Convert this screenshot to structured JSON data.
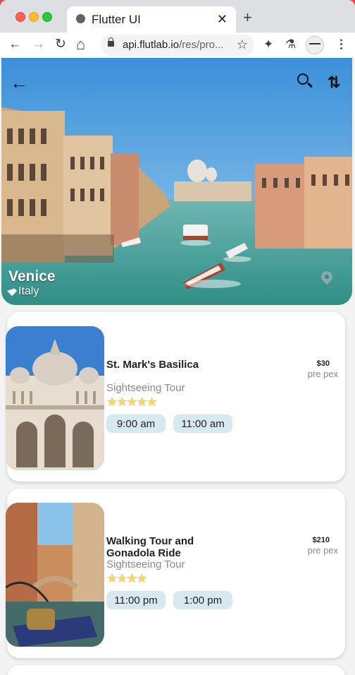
{
  "browser": {
    "tab_title": "Flutter UI",
    "tab_close": "✕",
    "new_tab": "+",
    "url_host": "api.flutlab.io",
    "url_path": "/res/pro...",
    "back": "←",
    "forward": "→",
    "reload": "↻",
    "home": "⌂",
    "star": "☆",
    "menu": "⋮",
    "extensions": "✦",
    "labs": "⚗"
  },
  "hero": {
    "back_icon": "←",
    "sort_icon": "⇅",
    "city": "Venice",
    "country": "Italy"
  },
  "activities": [
    {
      "name": "St. Mark's Basilica",
      "type": "Sightseeing Tour",
      "rating": 5,
      "stars": "★★★★★",
      "price": "$30",
      "per": "pre pex",
      "times": [
        "9:00 am",
        "11:00 am"
      ]
    },
    {
      "name": "Walking Tour and Gonadola Ride",
      "type": "Sightseeing Tour",
      "rating": 4,
      "stars": "★★★★",
      "price": "$210",
      "per": "pre pex",
      "times": [
        "11:00 pm",
        "1:00 pm"
      ]
    }
  ],
  "colors": {
    "accent_chip": "#d7e9ef",
    "star": "#f5d56b",
    "pin": "#8aa9a8"
  }
}
